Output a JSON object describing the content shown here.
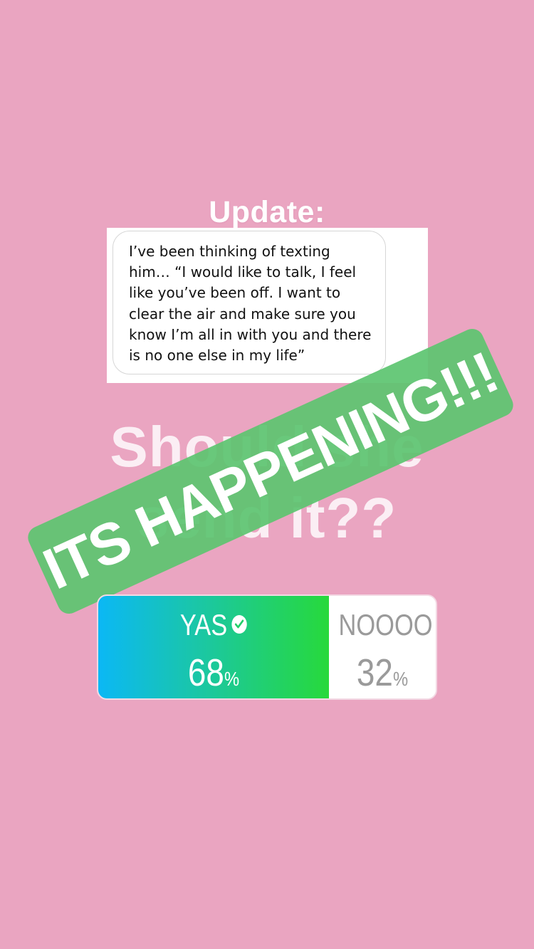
{
  "story": {
    "update_title": "Update:",
    "message": "I’ve been thinking of texting\nhim… “I would like to talk, I feel\nlike you’ve been off. I want to\nclear the air and make sure you\nknow I’m all in with you and there\nis no one else in my life”",
    "question": "Should she\nsend it??",
    "banner": "ITS HAPPENING!!!",
    "background_color": "#eaa5c1",
    "banner_color": "#5cc470"
  },
  "poll": {
    "yes_label": "YAS",
    "yes_percent": "68",
    "no_label": "NOOOO",
    "no_percent": "32",
    "percent_sign": "%",
    "selected": "YAS",
    "yes_icon": "check-circle-icon",
    "yes_share": 0.68
  }
}
